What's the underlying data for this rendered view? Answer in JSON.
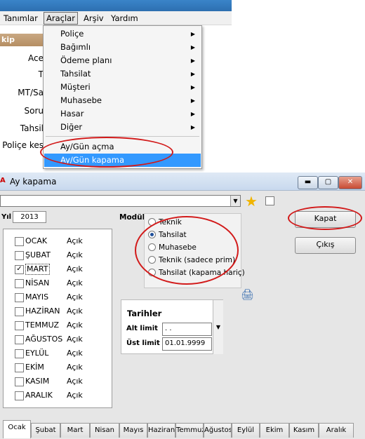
{
  "menubar": {
    "items": [
      "Tanımlar",
      "Araçlar",
      "Arşiv",
      "Yardım"
    ]
  },
  "background": {
    "header": "kip",
    "labels": [
      "Ace",
      "T",
      "MT/Sa",
      "Soru",
      "Tahsil",
      "Poliçe kes"
    ]
  },
  "dropdown": {
    "items": [
      "Poliçe",
      "Bağımlı",
      "Ödeme planı",
      "Tahsilat",
      "Müşteri",
      "Muhasebe",
      "Hasar",
      "Diğer"
    ],
    "extra_items": [
      "Ay/Gün açma",
      "Ay/Gün kapama"
    ],
    "selected": "Ay/Gün kapama"
  },
  "window": {
    "title": "Ay kapama",
    "title_icon": "A",
    "controls": {
      "minimize": "minimize-icon",
      "maximize": "maximize-icon",
      "close": "close-icon"
    },
    "year_label": "Yıl",
    "year_value": "2013",
    "months": [
      {
        "name": "OCAK",
        "status": "Açık",
        "checked": false
      },
      {
        "name": "ŞUBAT",
        "status": "Açık",
        "checked": false
      },
      {
        "name": "MART",
        "status": "Açık",
        "checked": true
      },
      {
        "name": "NİSAN",
        "status": "Açık",
        "checked": false
      },
      {
        "name": "MAYIS",
        "status": "Açık",
        "checked": false
      },
      {
        "name": "HAZİRAN",
        "status": "Açık",
        "checked": false
      },
      {
        "name": "TEMMUZ",
        "status": "Açık",
        "checked": false
      },
      {
        "name": "AĞUSTOS",
        "status": "Açık",
        "checked": false
      },
      {
        "name": "EYLÜL",
        "status": "Açık",
        "checked": false
      },
      {
        "name": "EKİM",
        "status": "Açık",
        "checked": false
      },
      {
        "name": "KASIM",
        "status": "Açık",
        "checked": false
      },
      {
        "name": "ARALIK",
        "status": "Açık",
        "checked": false
      }
    ],
    "modul_label": "Modül",
    "modul_options": [
      "Teknik",
      "Tahsilat",
      "Muhasebe",
      "Teknik (sadece prim)",
      "Tahsilat (kapama hariç)"
    ],
    "modul_selected": "Tahsilat",
    "buttons": {
      "kapat": "Kapat",
      "cikis": "Çıkış"
    },
    "tarihler": {
      "title": "Tarihler",
      "alt_label": "Alt limit",
      "alt_value": " .  .",
      "ust_label": "Üst limit",
      "ust_value": "01.01.9999"
    },
    "tabs": [
      "Ocak",
      "Şubat",
      "Mart",
      "Nisan",
      "Mayıs",
      "Haziran",
      "Temmuz",
      "Ağustos",
      "Eylül",
      "Ekim",
      "Kasım",
      "Aralık"
    ],
    "active_tab": "Ocak"
  },
  "annotation_color": "#d21a1a",
  "selection_color": "#3399ff"
}
